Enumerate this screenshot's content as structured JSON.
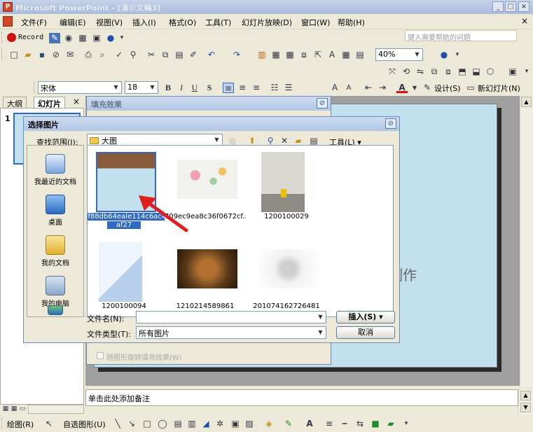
{
  "app": {
    "title": "Microsoft PowerPoint - [演示文稿3]",
    "window_buttons": [
      "_",
      "□",
      "×"
    ],
    "menu": [
      "文件(F)",
      "编辑(E)",
      "视图(V)",
      "插入(I)",
      "格式(O)",
      "工具(T)",
      "幻灯片放映(D)",
      "窗口(W)",
      "帮助(H)"
    ],
    "help_placeholder": "键入需要帮助的问题",
    "record_label": "Record"
  },
  "toolbar": {
    "zoom": "40%",
    "font_name": "宋体",
    "font_size": "18",
    "bold": "B",
    "italic": "I",
    "underline": "U",
    "shadow": "S",
    "design_label": "设计(S)",
    "new_slide_label": "新幻灯片(N)"
  },
  "panel": {
    "tab_outline": "大纲",
    "tab_slides": "幻灯片",
    "close": "×",
    "slide_number": "1"
  },
  "slide": {
    "partial_text": "制作"
  },
  "notes": {
    "placeholder": "单击此处添加备注"
  },
  "drawing_toolbar": {
    "draw_label": "绘图(R)",
    "autoshapes_label": "自选图形(U)"
  },
  "fill_dialog": {
    "title": "填充效果",
    "checkbox_label": "随图形旋转填充效果(W)"
  },
  "picture_dialog": {
    "title": "选择图片",
    "look_in_label": "查找范围(I):",
    "look_in_value": "大图",
    "tools_label": "工具(L)",
    "places": [
      {
        "label": "我最近的文档",
        "icon": "recent-documents-icon"
      },
      {
        "label": "桌面",
        "icon": "desktop-icon"
      },
      {
        "label": "我的文档",
        "icon": "my-documents-icon"
      },
      {
        "label": "我的电脑",
        "icon": "my-computer-icon"
      },
      {
        "label": "",
        "icon": "network-places-icon"
      }
    ],
    "files": [
      {
        "caption_line1": "4f88db64eale114c6ac4",
        "caption_line2": "af27",
        "selected": true
      },
      {
        "caption_line1": "709ec9ea8c36f0672cf...",
        "caption_line2": "",
        "selected": false
      },
      {
        "caption_line1": "1200100029",
        "caption_line2": "",
        "selected": false
      },
      {
        "caption_line1": "1200100094",
        "caption_line2": "",
        "selected": false
      },
      {
        "caption_line1": "1210214589861",
        "caption_line2": "",
        "selected": false
      },
      {
        "caption_line1": "201074162726481",
        "caption_line2": "",
        "selected": false
      }
    ],
    "filename_label": "文件名(N):",
    "filename_value": "",
    "filetype_label": "文件类型(T):",
    "filetype_value": "所有图片",
    "insert_label": "插入(S)",
    "cancel_label": "取消"
  },
  "colors": {
    "arrow": "#e02020",
    "selection": "#316ac5",
    "slide_bg": "#c3e0ef"
  }
}
